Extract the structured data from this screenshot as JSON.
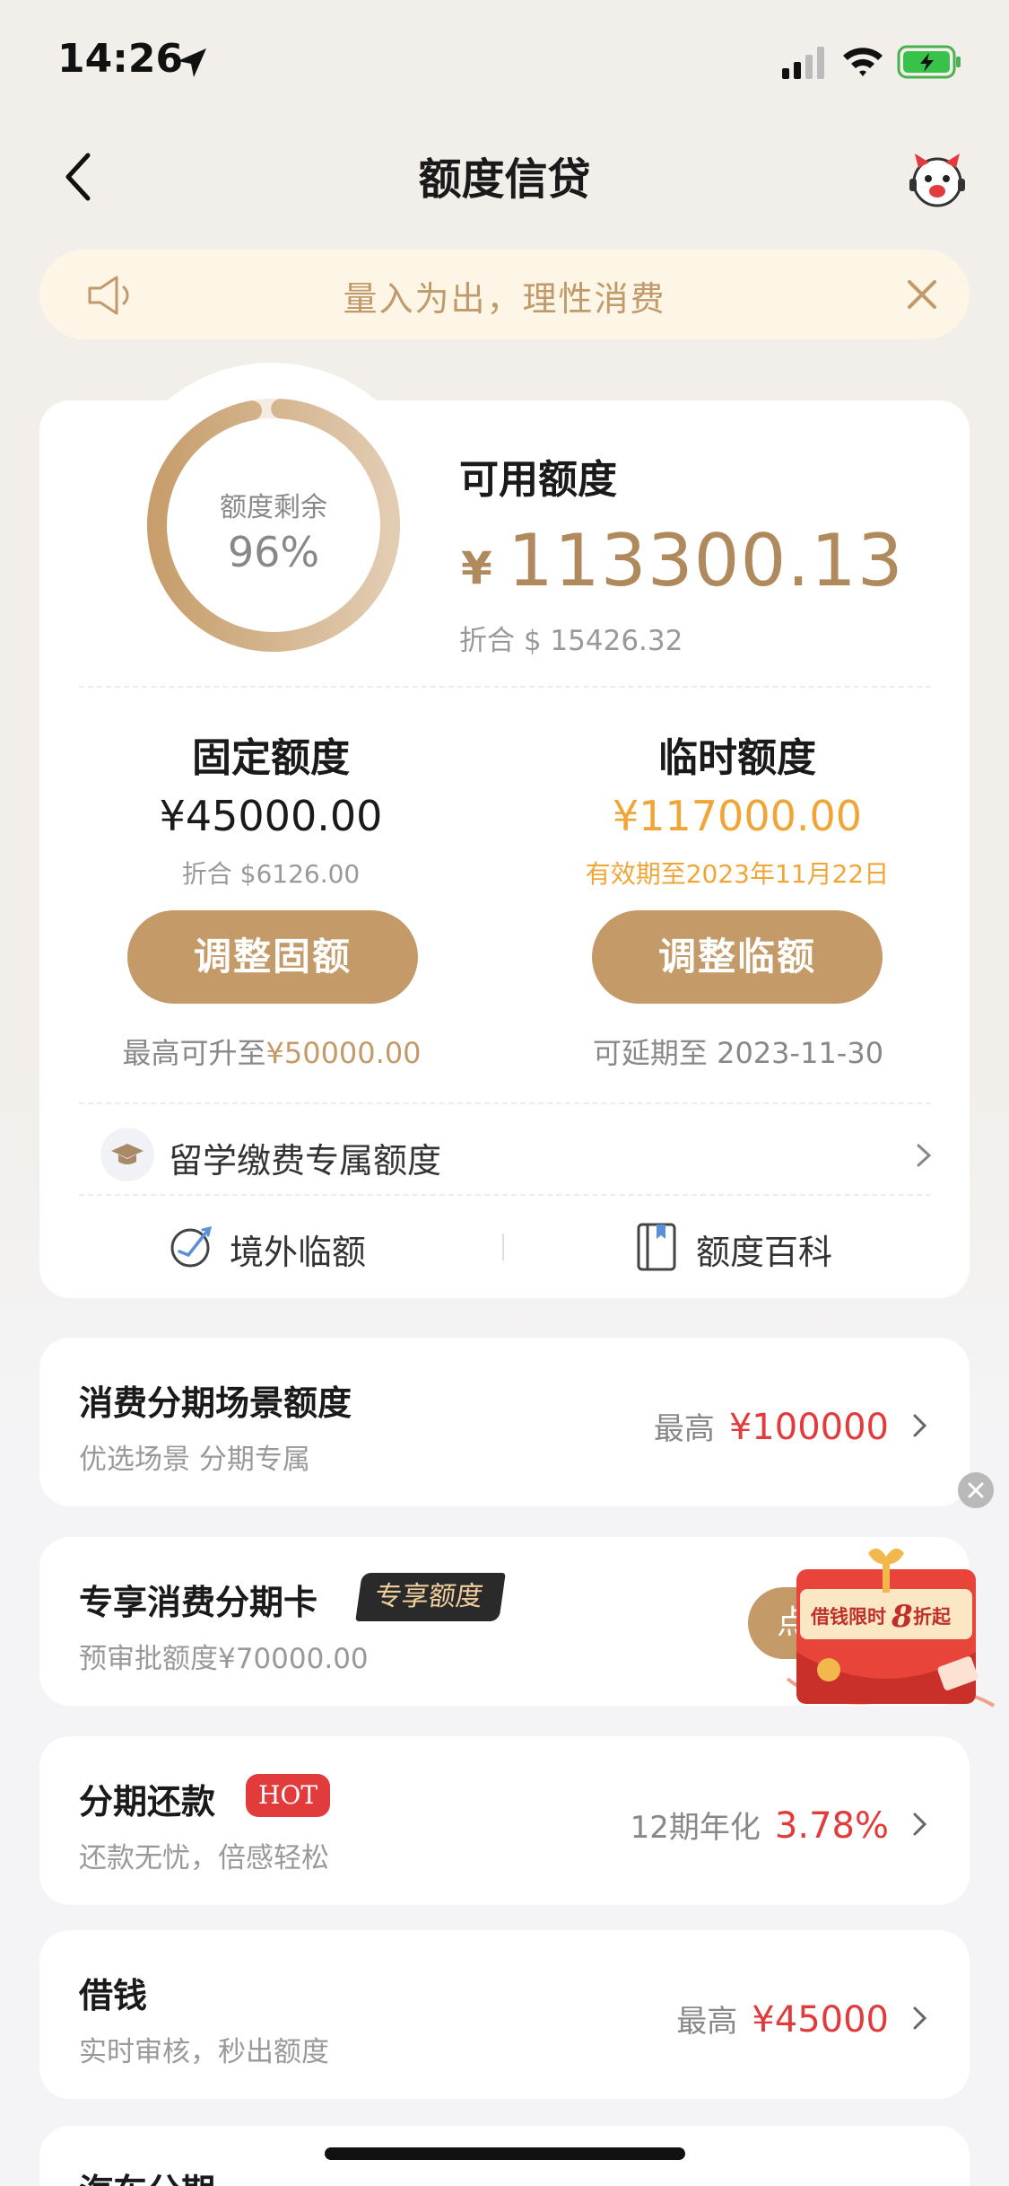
{
  "status_bar": {
    "time": "14:26"
  },
  "nav": {
    "title": "额度信贷"
  },
  "notice": {
    "text": "量入为出，理性消费"
  },
  "summary": {
    "ring_label": "额度剩余",
    "ring_percent": "96%",
    "ring_fraction": 0.96,
    "available_label": "可用额度",
    "currency_symbol": "¥",
    "available_amount": "113300.13",
    "available_usd": "折合 $ 15426.32"
  },
  "fixed": {
    "title": "固定额度",
    "amount": "¥45000.00",
    "usd": "折合 $6126.00",
    "button": "调整固额",
    "note_prefix": "最高可升至",
    "note_value": "¥50000.00"
  },
  "temporary": {
    "title": "临时额度",
    "amount": "¥117000.00",
    "validity": "有效期至2023年11月22日",
    "button": "调整临额",
    "note": "可延期至 2023-11-30"
  },
  "study_row": {
    "label": "留学缴费专属额度"
  },
  "quick_links": {
    "abroad": "境外临额",
    "wiki": "额度百科"
  },
  "cards": {
    "scene": {
      "title": "消费分期场景额度",
      "sub": "优选场景 分期专属",
      "right_label": "最高",
      "right_value": "¥100000"
    },
    "exclusive": {
      "title": "专享消费分期卡",
      "badge": "专享额度",
      "sub": "预审批额度¥70000.00",
      "button": "点"
    },
    "installment": {
      "title": "分期还款",
      "badge": "HOT",
      "sub": "还款无忧，倍感轻松",
      "right_label": "12期年化",
      "right_value": "3.78%"
    },
    "borrow": {
      "title": "借钱",
      "sub": "实时审核，秒出额度",
      "right_label": "最高",
      "right_value": "¥45000"
    },
    "car": {
      "title": "汽车分期"
    }
  },
  "promo": {
    "text_prefix": "借钱限时",
    "text_number": "8",
    "text_suffix": "折起"
  },
  "colors": {
    "gold": "#c39a68",
    "orange": "#f0a637",
    "red": "#e23b3b"
  }
}
